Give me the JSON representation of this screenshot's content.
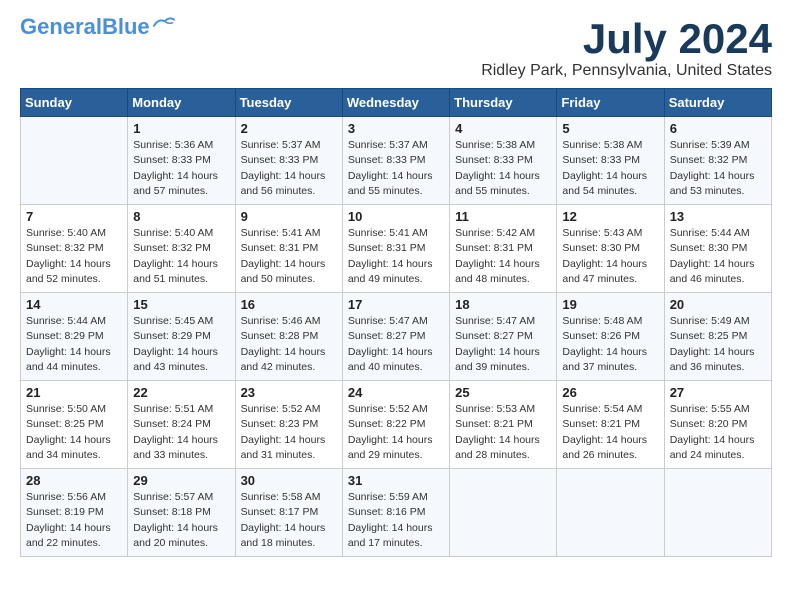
{
  "logo": {
    "general": "General",
    "blue": "Blue"
  },
  "title": {
    "month_year": "July 2024",
    "location": "Ridley Park, Pennsylvania, United States"
  },
  "days_of_week": [
    "Sunday",
    "Monday",
    "Tuesday",
    "Wednesday",
    "Thursday",
    "Friday",
    "Saturday"
  ],
  "weeks": [
    [
      {
        "day": "",
        "content": ""
      },
      {
        "day": "1",
        "content": "Sunrise: 5:36 AM\nSunset: 8:33 PM\nDaylight: 14 hours\nand 57 minutes."
      },
      {
        "day": "2",
        "content": "Sunrise: 5:37 AM\nSunset: 8:33 PM\nDaylight: 14 hours\nand 56 minutes."
      },
      {
        "day": "3",
        "content": "Sunrise: 5:37 AM\nSunset: 8:33 PM\nDaylight: 14 hours\nand 55 minutes."
      },
      {
        "day": "4",
        "content": "Sunrise: 5:38 AM\nSunset: 8:33 PM\nDaylight: 14 hours\nand 55 minutes."
      },
      {
        "day": "5",
        "content": "Sunrise: 5:38 AM\nSunset: 8:33 PM\nDaylight: 14 hours\nand 54 minutes."
      },
      {
        "day": "6",
        "content": "Sunrise: 5:39 AM\nSunset: 8:32 PM\nDaylight: 14 hours\nand 53 minutes."
      }
    ],
    [
      {
        "day": "7",
        "content": "Sunrise: 5:40 AM\nSunset: 8:32 PM\nDaylight: 14 hours\nand 52 minutes."
      },
      {
        "day": "8",
        "content": "Sunrise: 5:40 AM\nSunset: 8:32 PM\nDaylight: 14 hours\nand 51 minutes."
      },
      {
        "day": "9",
        "content": "Sunrise: 5:41 AM\nSunset: 8:31 PM\nDaylight: 14 hours\nand 50 minutes."
      },
      {
        "day": "10",
        "content": "Sunrise: 5:41 AM\nSunset: 8:31 PM\nDaylight: 14 hours\nand 49 minutes."
      },
      {
        "day": "11",
        "content": "Sunrise: 5:42 AM\nSunset: 8:31 PM\nDaylight: 14 hours\nand 48 minutes."
      },
      {
        "day": "12",
        "content": "Sunrise: 5:43 AM\nSunset: 8:30 PM\nDaylight: 14 hours\nand 47 minutes."
      },
      {
        "day": "13",
        "content": "Sunrise: 5:44 AM\nSunset: 8:30 PM\nDaylight: 14 hours\nand 46 minutes."
      }
    ],
    [
      {
        "day": "14",
        "content": "Sunrise: 5:44 AM\nSunset: 8:29 PM\nDaylight: 14 hours\nand 44 minutes."
      },
      {
        "day": "15",
        "content": "Sunrise: 5:45 AM\nSunset: 8:29 PM\nDaylight: 14 hours\nand 43 minutes."
      },
      {
        "day": "16",
        "content": "Sunrise: 5:46 AM\nSunset: 8:28 PM\nDaylight: 14 hours\nand 42 minutes."
      },
      {
        "day": "17",
        "content": "Sunrise: 5:47 AM\nSunset: 8:27 PM\nDaylight: 14 hours\nand 40 minutes."
      },
      {
        "day": "18",
        "content": "Sunrise: 5:47 AM\nSunset: 8:27 PM\nDaylight: 14 hours\nand 39 minutes."
      },
      {
        "day": "19",
        "content": "Sunrise: 5:48 AM\nSunset: 8:26 PM\nDaylight: 14 hours\nand 37 minutes."
      },
      {
        "day": "20",
        "content": "Sunrise: 5:49 AM\nSunset: 8:25 PM\nDaylight: 14 hours\nand 36 minutes."
      }
    ],
    [
      {
        "day": "21",
        "content": "Sunrise: 5:50 AM\nSunset: 8:25 PM\nDaylight: 14 hours\nand 34 minutes."
      },
      {
        "day": "22",
        "content": "Sunrise: 5:51 AM\nSunset: 8:24 PM\nDaylight: 14 hours\nand 33 minutes."
      },
      {
        "day": "23",
        "content": "Sunrise: 5:52 AM\nSunset: 8:23 PM\nDaylight: 14 hours\nand 31 minutes."
      },
      {
        "day": "24",
        "content": "Sunrise: 5:52 AM\nSunset: 8:22 PM\nDaylight: 14 hours\nand 29 minutes."
      },
      {
        "day": "25",
        "content": "Sunrise: 5:53 AM\nSunset: 8:21 PM\nDaylight: 14 hours\nand 28 minutes."
      },
      {
        "day": "26",
        "content": "Sunrise: 5:54 AM\nSunset: 8:21 PM\nDaylight: 14 hours\nand 26 minutes."
      },
      {
        "day": "27",
        "content": "Sunrise: 5:55 AM\nSunset: 8:20 PM\nDaylight: 14 hours\nand 24 minutes."
      }
    ],
    [
      {
        "day": "28",
        "content": "Sunrise: 5:56 AM\nSunset: 8:19 PM\nDaylight: 14 hours\nand 22 minutes."
      },
      {
        "day": "29",
        "content": "Sunrise: 5:57 AM\nSunset: 8:18 PM\nDaylight: 14 hours\nand 20 minutes."
      },
      {
        "day": "30",
        "content": "Sunrise: 5:58 AM\nSunset: 8:17 PM\nDaylight: 14 hours\nand 18 minutes."
      },
      {
        "day": "31",
        "content": "Sunrise: 5:59 AM\nSunset: 8:16 PM\nDaylight: 14 hours\nand 17 minutes."
      },
      {
        "day": "",
        "content": ""
      },
      {
        "day": "",
        "content": ""
      },
      {
        "day": "",
        "content": ""
      }
    ]
  ]
}
